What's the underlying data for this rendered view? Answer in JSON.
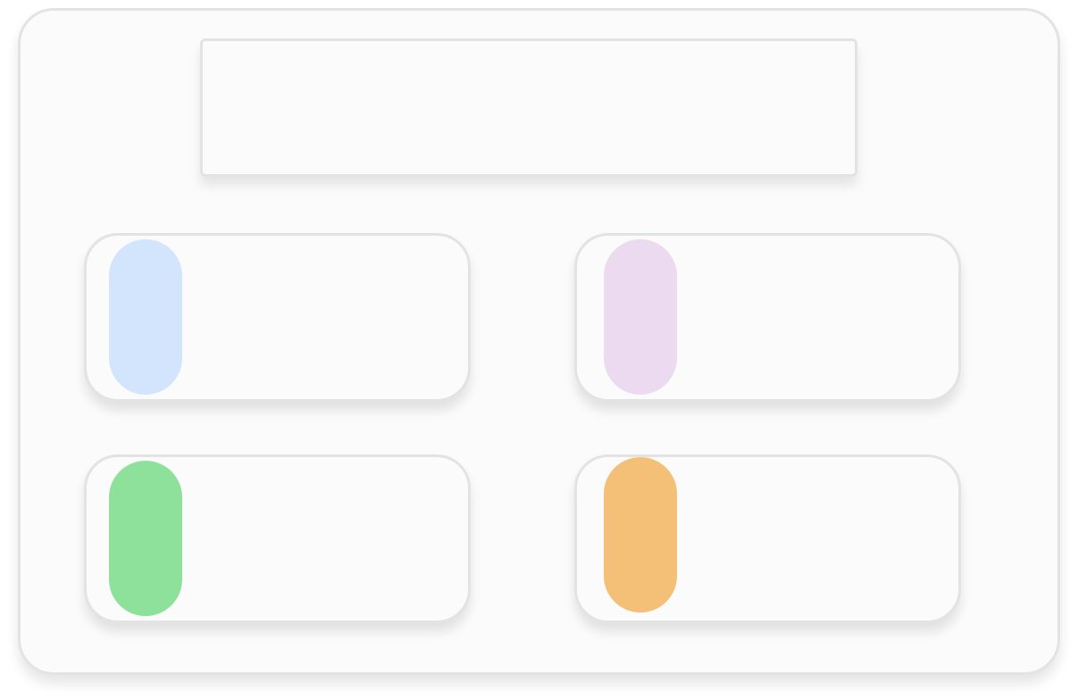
{
  "header": {
    "text": ""
  },
  "cards": [
    {
      "id": "tl",
      "label": "",
      "accent": "#d3e5fd"
    },
    {
      "id": "tr",
      "label": "",
      "accent": "#ecdaf0"
    },
    {
      "id": "bl",
      "label": "",
      "accent": "#8ee19a"
    },
    {
      "id": "br",
      "label": "",
      "accent": "#f4c078"
    }
  ]
}
